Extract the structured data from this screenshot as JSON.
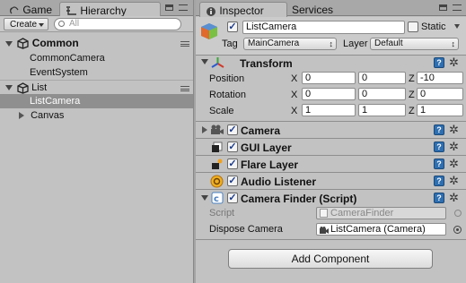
{
  "hierarchy": {
    "tabs": {
      "game": "Game",
      "hierarchy": "Hierarchy"
    },
    "create_label": "Create",
    "search_placeholder": "All",
    "rows": {
      "common": "Common",
      "common_camera": "CommonCamera",
      "event_system": "EventSystem",
      "list": "List",
      "list_camera": "ListCamera",
      "canvas": "Canvas"
    }
  },
  "inspector": {
    "tabs": {
      "inspector": "Inspector",
      "services": "Services"
    },
    "object_name": "ListCamera",
    "static_label": "Static",
    "tag_label": "Tag",
    "tag_value": "MainCamera",
    "layer_label": "Layer",
    "layer_value": "Default",
    "transform": {
      "title": "Transform",
      "position_label": "Position",
      "rotation_label": "Rotation",
      "scale_label": "Scale",
      "axes": {
        "x": "X",
        "y": "Y",
        "z": "Z"
      },
      "position": {
        "x": "0",
        "y": "0",
        "z": "-10"
      },
      "rotation": {
        "x": "0",
        "y": "0",
        "z": "0"
      },
      "scale": {
        "x": "1",
        "y": "1",
        "z": "1"
      }
    },
    "components": {
      "camera": "Camera",
      "gui_layer": "GUI Layer",
      "flare_layer": "Flare Layer",
      "audio_listener": "Audio Listener",
      "camera_finder": "Camera Finder (Script)"
    },
    "script_label": "Script",
    "script_value": "CameraFinder",
    "dispose_label": "Dispose Camera",
    "dispose_value": "ListCamera (Camera)",
    "add_component": "Add Component",
    "help_glyph": "?"
  },
  "colors": {
    "selection": "#8f8f8f",
    "help_blue": "#2f6fb0",
    "panel_bg": "#c2c2c2"
  },
  "icons": [
    "game-icon",
    "hierarchy-icon",
    "inspector-icon",
    "unity-scene-icon",
    "gameobject-cube-icon",
    "transform-axes-icon",
    "camera-icon",
    "gui-layer-icon",
    "flare-layer-icon",
    "audio-listener-icon",
    "script-icon",
    "help-icon",
    "gear-icon",
    "object-picker-icon"
  ]
}
